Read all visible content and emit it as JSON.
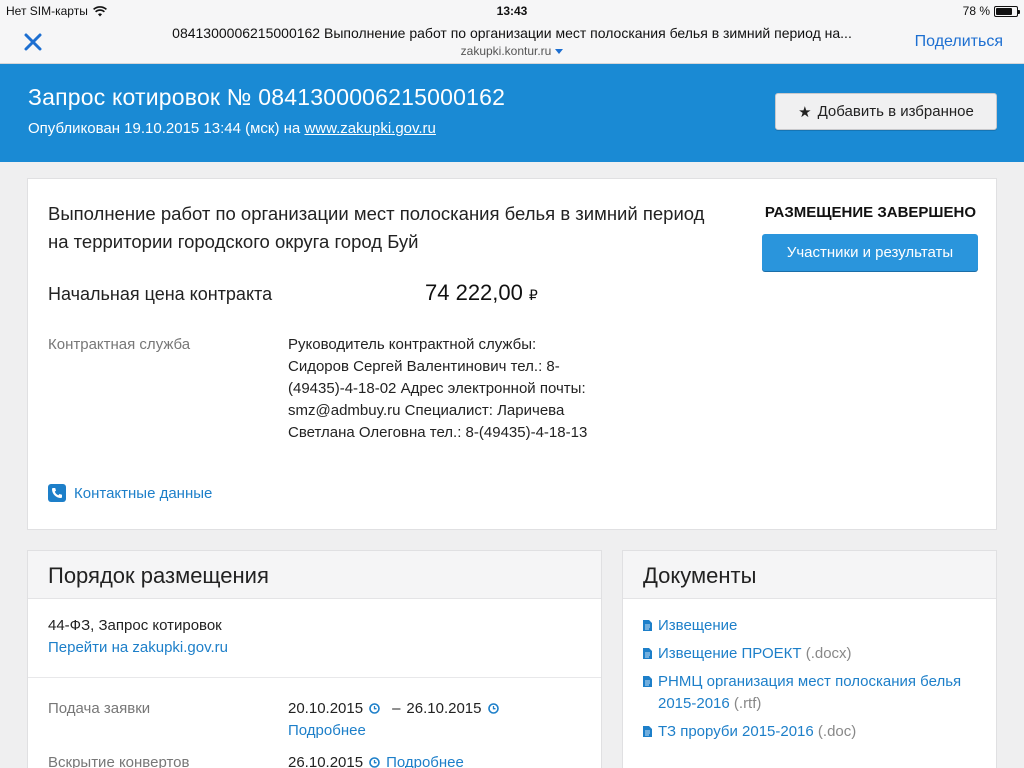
{
  "status_bar": {
    "carrier": "Нет SIM-карты",
    "time": "13:43",
    "battery": "78 %",
    "battery_level": 0.78
  },
  "browser": {
    "page_title": "0841300006215000162 Выполнение работ по организации мест полоскания белья в зимний период на...",
    "domain": "zakupki.kontur.ru",
    "share_label": "Поделиться"
  },
  "header": {
    "title": "Запрос котировок № 0841300006215000162",
    "published_prefix": "Опубликован 19.10.2015 13:44 (мск) на ",
    "published_link": "www.zakupki.gov.ru",
    "favorite_label": "Добавить в избранное"
  },
  "lot": {
    "title": "Выполнение работ по организации мест полоскания белья в зимний период на территории городского округа город Буй",
    "status": "РАЗМЕЩЕНИЕ ЗАВЕРШЕНО",
    "results_label": "Участники и результаты",
    "price_label": "Начальная цена контракта",
    "price_value": "74 222,00",
    "currency": "₽",
    "service_label": "Контрактная служба",
    "service_value": "Руководитель контрактной службы: Сидоров Сергей Валентинович тел.: 8-(49435)-4-18-02 Адрес электронной почты: smz@admbuy.ru Специалист: Ларичева Светлана Олеговна тел.: 8-(49435)-4-18-13",
    "contacts_label": "Контактные данные"
  },
  "procedure": {
    "heading": "Порядок размещения",
    "law": "44-ФЗ, Запрос котировок",
    "link": "Перейти на zakupki.gov.ru",
    "rows": [
      {
        "label": "Подача заявки",
        "from": "20.10.2015",
        "dash": "–",
        "to": "26.10.2015",
        "more": "Подробнее"
      },
      {
        "label": "Вскрытие конвертов",
        "date": "26.10.2015",
        "more": "Подробнее"
      }
    ]
  },
  "documents": {
    "heading": "Документы",
    "items": [
      {
        "name": "Извещение",
        "ext": ""
      },
      {
        "name": "Извещение ПРОЕКТ",
        "ext": " (.docx)"
      },
      {
        "name": "РНМЦ организация мест полоскания белья 2015-2016",
        "ext": " (.rtf)"
      },
      {
        "name": "ТЗ проруби 2015-2016",
        "ext": " (.doc)"
      }
    ]
  },
  "colors": {
    "accent": "#1a8ad4",
    "link": "#1d7fc9",
    "button": "#2a95dc"
  }
}
